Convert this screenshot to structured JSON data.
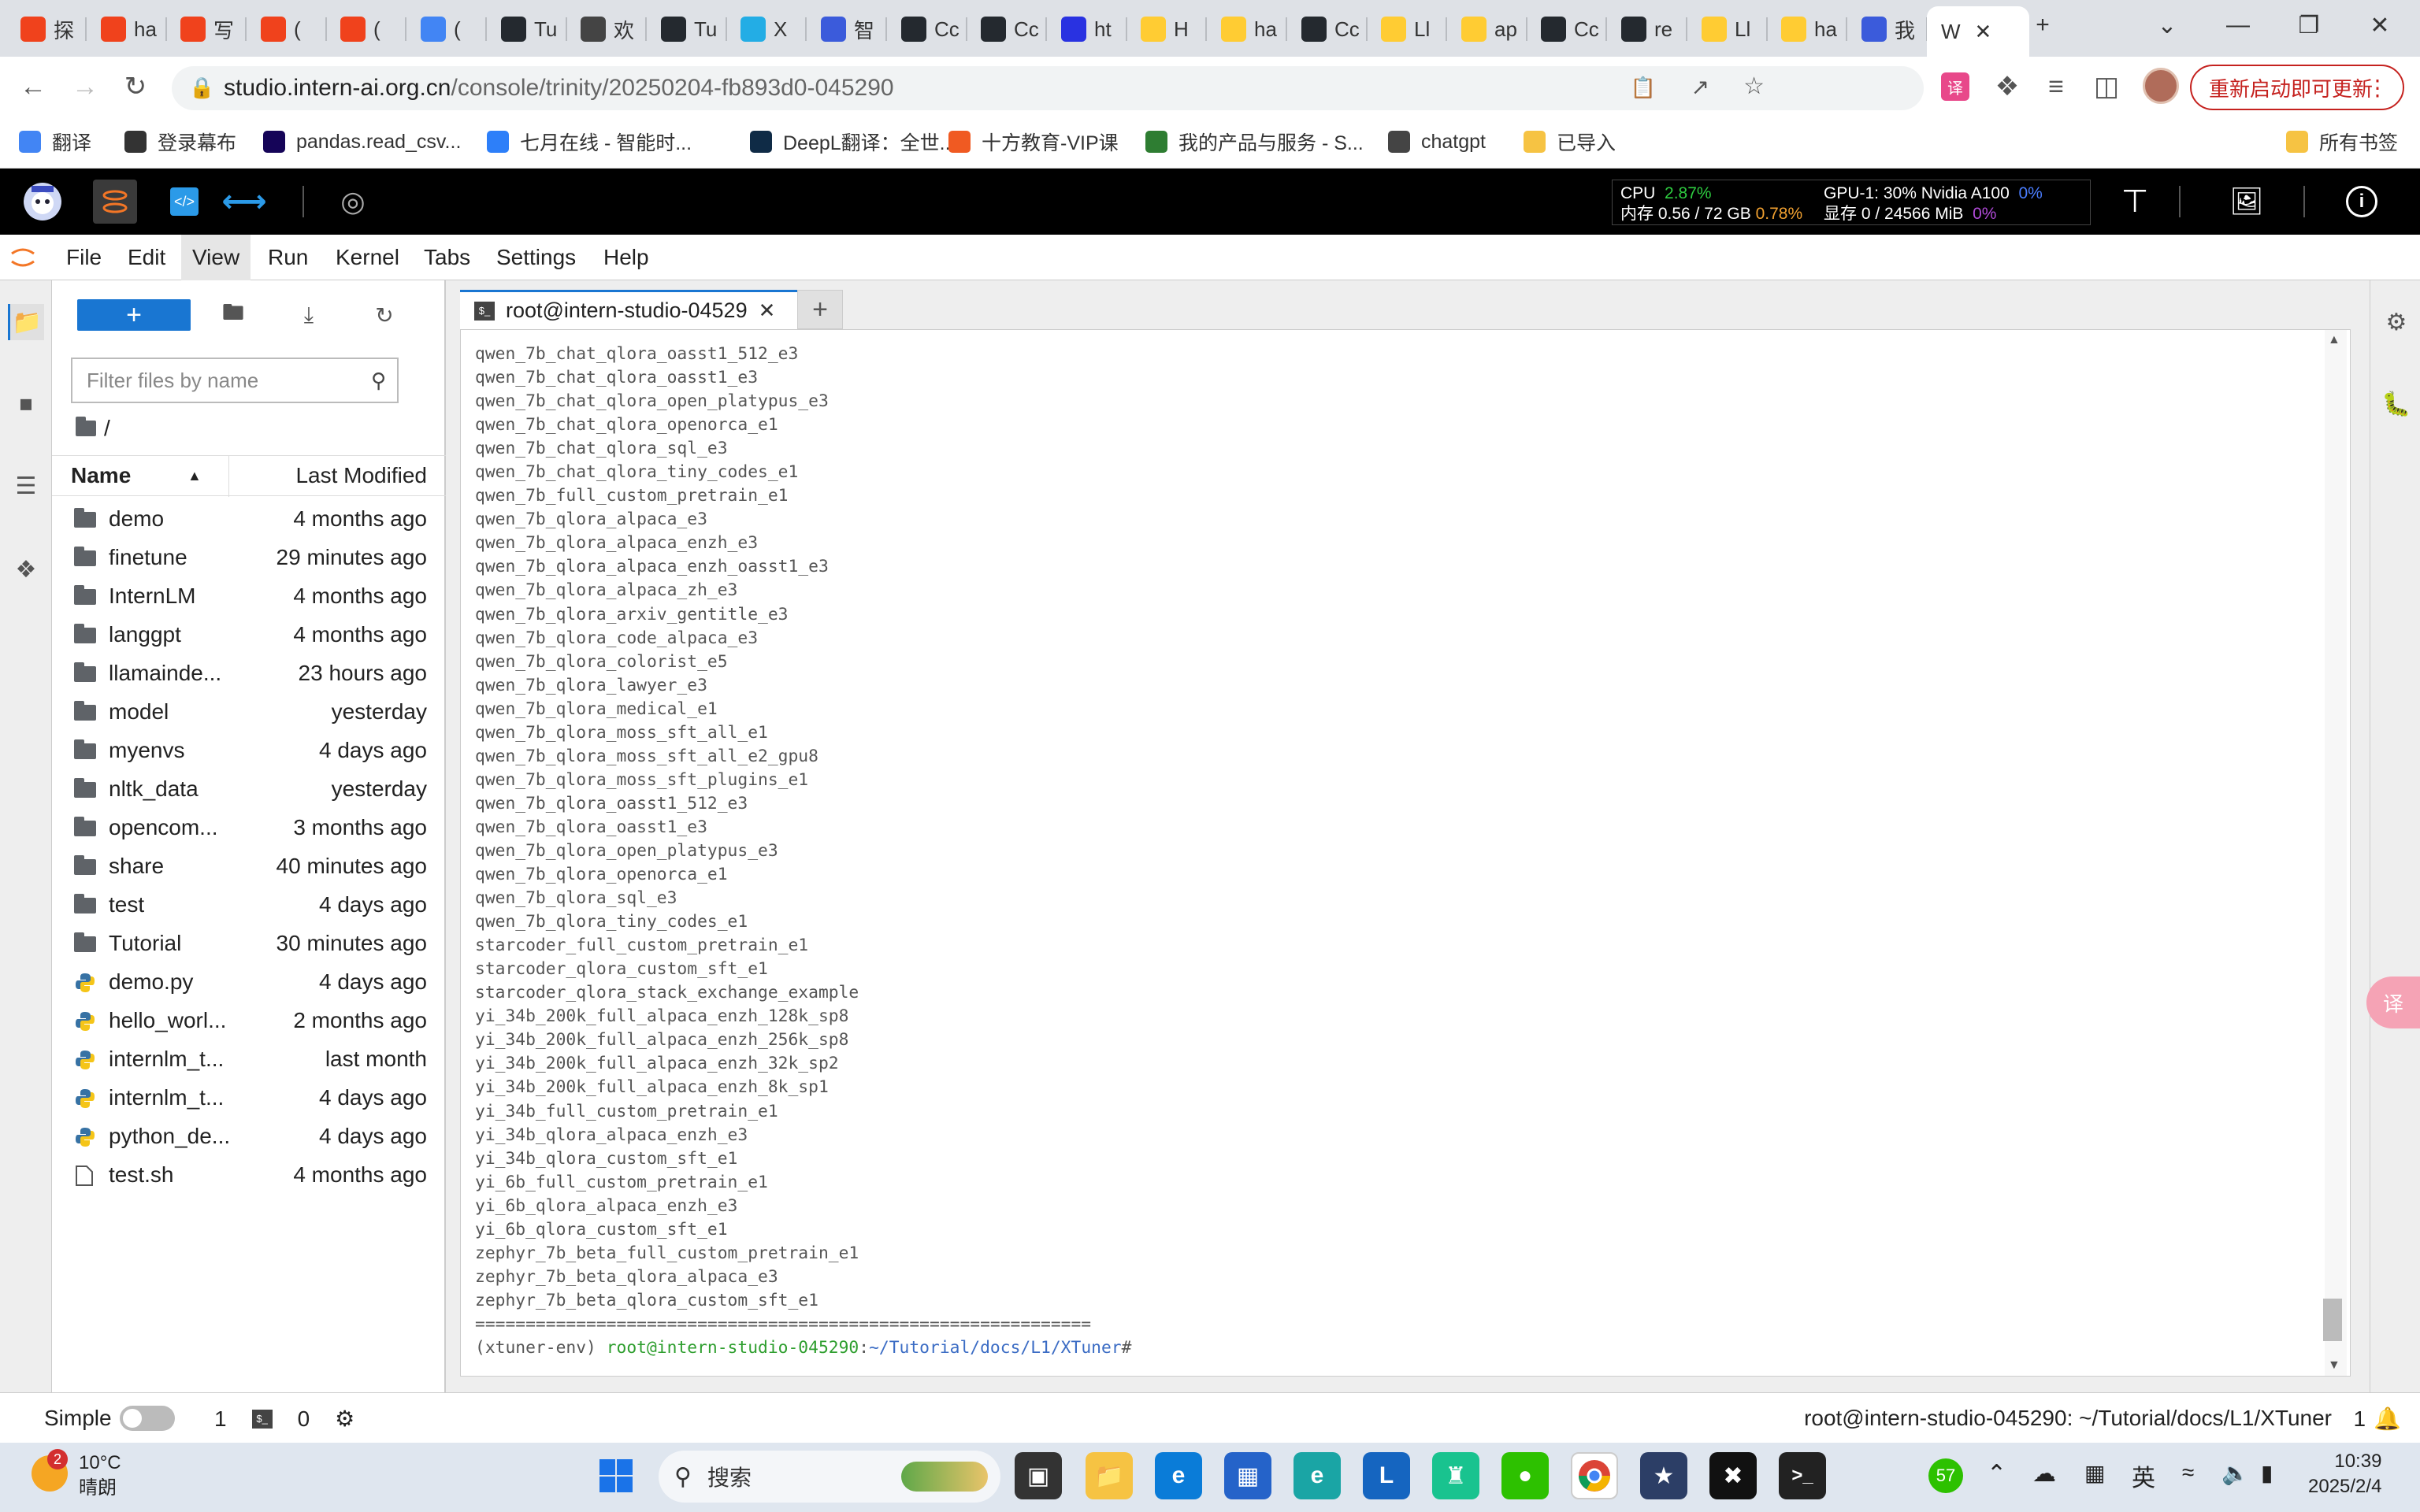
{
  "browser": {
    "tabs": [
      {
        "label": "探",
        "icon": "csdn-icon",
        "color": "#f0421c"
      },
      {
        "label": "ha",
        "icon": "csdn-icon",
        "color": "#f0421c"
      },
      {
        "label": "写",
        "icon": "csdn-icon",
        "color": "#f0421c"
      },
      {
        "label": "(",
        "icon": "csdn-icon",
        "color": "#f0421c"
      },
      {
        "label": "(",
        "icon": "csdn-icon",
        "color": "#f0421c"
      },
      {
        "label": "(",
        "icon": "docs-icon",
        "color": "#4285f4"
      },
      {
        "label": "Tu",
        "icon": "github-icon",
        "color": "#24292f"
      },
      {
        "label": "欢",
        "icon": "reader-icon",
        "color": "#444444"
      },
      {
        "label": "Tu",
        "icon": "github-icon",
        "color": "#24292f"
      },
      {
        "label": "X",
        "icon": "bilibili-icon",
        "color": "#23ade5"
      },
      {
        "label": "智",
        "icon": "intern-icon",
        "color": "#3b5bdb"
      },
      {
        "label": "Cc",
        "icon": "github-icon",
        "color": "#24292f"
      },
      {
        "label": "Cc",
        "icon": "github-icon",
        "color": "#24292f"
      },
      {
        "label": "ht",
        "icon": "baidu-icon",
        "color": "#2932e1"
      },
      {
        "label": "H",
        "icon": "huggingface-icon",
        "color": "#ffcc33"
      },
      {
        "label": "ha",
        "icon": "huggingface-icon",
        "color": "#ffcc33"
      },
      {
        "label": "Cc",
        "icon": "github-icon",
        "color": "#24292f"
      },
      {
        "label": "Ll",
        "icon": "huggingface-icon",
        "color": "#ffcc33"
      },
      {
        "label": "ap",
        "icon": "huggingface-icon",
        "color": "#ffcc33"
      },
      {
        "label": "Cc",
        "icon": "github-icon",
        "color": "#24292f"
      },
      {
        "label": "re",
        "icon": "github-icon",
        "color": "#24292f"
      },
      {
        "label": "Ll",
        "icon": "huggingface-icon",
        "color": "#ffcc33"
      },
      {
        "label": "ha",
        "icon": "huggingface-icon",
        "color": "#ffcc33"
      },
      {
        "label": "我",
        "icon": "intern-icon",
        "color": "#3b5bdb"
      },
      {
        "label": "W",
        "icon": "",
        "color": "#ffffff",
        "active": true
      }
    ],
    "new_tab": "+",
    "url_domain": "studio.intern-ai.org.cn",
    "url_path": "/console/trinity/20250204-fb893d0-045290",
    "update_button": "重新启动即可更新",
    "bookmarks": [
      {
        "label": "翻译",
        "icon": "translate-icon",
        "color": "#4285f4"
      },
      {
        "label": "登录幕布",
        "icon": "mubu-icon",
        "color": "#333333"
      },
      {
        "label": "pandas.read_csv...",
        "icon": "pandas-icon",
        "color": "#150458"
      },
      {
        "label": "七月在线 - 智能时...",
        "icon": "julyedu-icon",
        "color": "#2d7ff9"
      },
      {
        "label": "DeepL翻译：全世...",
        "icon": "deepl-icon",
        "color": "#0f2b46"
      },
      {
        "label": "十方教育-VIP课",
        "icon": "shifang-icon",
        "color": "#f05a22"
      },
      {
        "label": "我的产品与服务 - S...",
        "icon": "service-icon",
        "color": "#2e7d32"
      },
      {
        "label": "chatgpt",
        "icon": "openai-icon",
        "color": "#444444"
      },
      {
        "label": "已导入",
        "icon": "folder-icon",
        "color": "#f6c343"
      }
    ],
    "all_bookmarks": "所有书签"
  },
  "jupyter": {
    "monitor": {
      "cpu_label": "CPU",
      "cpu_value": "2.87%",
      "mem_label": "内存 0.56 / 72 GB",
      "mem_value": "0.78%",
      "gpu_label": "GPU-1: 30% Nvidia A100",
      "gpu_value": "0%",
      "vram_label": "显存 0 / 24566 MiB",
      "vram_value": "0%"
    },
    "menu": [
      "File",
      "Edit",
      "View",
      "Run",
      "Kernel",
      "Tabs",
      "Settings",
      "Help"
    ],
    "filter_placeholder": "Filter files by name",
    "breadcrumb": "/",
    "col_name": "Name",
    "col_modified": "Last Modified",
    "files": [
      {
        "name": "demo",
        "modified": "4 months ago",
        "type": "folder"
      },
      {
        "name": "finetune",
        "modified": "29 minutes ago",
        "type": "folder"
      },
      {
        "name": "InternLM",
        "modified": "4 months ago",
        "type": "folder"
      },
      {
        "name": "langgpt",
        "modified": "4 months ago",
        "type": "folder"
      },
      {
        "name": "llamainde...",
        "modified": "23 hours ago",
        "type": "folder"
      },
      {
        "name": "model",
        "modified": "yesterday",
        "type": "folder"
      },
      {
        "name": "myenvs",
        "modified": "4 days ago",
        "type": "folder"
      },
      {
        "name": "nltk_data",
        "modified": "yesterday",
        "type": "folder"
      },
      {
        "name": "opencom...",
        "modified": "3 months ago",
        "type": "folder"
      },
      {
        "name": "share",
        "modified": "40 minutes ago",
        "type": "folder"
      },
      {
        "name": "test",
        "modified": "4 days ago",
        "type": "folder"
      },
      {
        "name": "Tutorial",
        "modified": "30 minutes ago",
        "type": "folder"
      },
      {
        "name": "demo.py",
        "modified": "4 days ago",
        "type": "python"
      },
      {
        "name": "hello_worl...",
        "modified": "2 months ago",
        "type": "python"
      },
      {
        "name": "internlm_t...",
        "modified": "last month",
        "type": "python"
      },
      {
        "name": "internlm_t...",
        "modified": "4 days ago",
        "type": "python"
      },
      {
        "name": "python_de...",
        "modified": "4 days ago",
        "type": "python"
      },
      {
        "name": "test.sh",
        "modified": "4 months ago",
        "type": "file"
      }
    ],
    "terminal_tab": "root@intern-studio-04529",
    "terminal_lines": [
      "qwen_7b_chat_qlora_oasst1_512_e3",
      "qwen_7b_chat_qlora_oasst1_e3",
      "qwen_7b_chat_qlora_open_platypus_e3",
      "qwen_7b_chat_qlora_openorca_e1",
      "qwen_7b_chat_qlora_sql_e3",
      "qwen_7b_chat_qlora_tiny_codes_e1",
      "qwen_7b_full_custom_pretrain_e1",
      "qwen_7b_qlora_alpaca_e3",
      "qwen_7b_qlora_alpaca_enzh_e3",
      "qwen_7b_qlora_alpaca_enzh_oasst1_e3",
      "qwen_7b_qlora_alpaca_zh_e3",
      "qwen_7b_qlora_arxiv_gentitle_e3",
      "qwen_7b_qlora_code_alpaca_e3",
      "qwen_7b_qlora_colorist_e5",
      "qwen_7b_qlora_lawyer_e3",
      "qwen_7b_qlora_medical_e1",
      "qwen_7b_qlora_moss_sft_all_e1",
      "qwen_7b_qlora_moss_sft_all_e2_gpu8",
      "qwen_7b_qlora_moss_sft_plugins_e1",
      "qwen_7b_qlora_oasst1_512_e3",
      "qwen_7b_qlora_oasst1_e3",
      "qwen_7b_qlora_open_platypus_e3",
      "qwen_7b_qlora_openorca_e1",
      "qwen_7b_qlora_sql_e3",
      "qwen_7b_qlora_tiny_codes_e1",
      "starcoder_full_custom_pretrain_e1",
      "starcoder_qlora_custom_sft_e1",
      "starcoder_qlora_stack_exchange_example",
      "yi_34b_200k_full_alpaca_enzh_128k_sp8",
      "yi_34b_200k_full_alpaca_enzh_256k_sp8",
      "yi_34b_200k_full_alpaca_enzh_32k_sp2",
      "yi_34b_200k_full_alpaca_enzh_8k_sp1",
      "yi_34b_full_custom_pretrain_e1",
      "yi_34b_qlora_alpaca_enzh_e3",
      "yi_34b_qlora_custom_sft_e1",
      "yi_6b_full_custom_pretrain_e1",
      "yi_6b_qlora_alpaca_enzh_e3",
      "yi_6b_qlora_custom_sft_e1",
      "zephyr_7b_beta_full_custom_pretrain_e1",
      "zephyr_7b_beta_qlora_alpaca_e3",
      "zephyr_7b_beta_qlora_custom_sft_e1",
      "============================================================="
    ],
    "prompt_env": "(xtuner-env) ",
    "prompt_user": "root@intern-studio-045290",
    "prompt_colon": ":",
    "prompt_path": "~/Tutorial/docs/L1/XTuner",
    "prompt_end": "#",
    "status": {
      "mode": "Simple",
      "count1": "1",
      "count2": "0",
      "path": "root@intern-studio-045290: ~/Tutorial/docs/L1/XTuner",
      "notifications": "1"
    }
  },
  "taskbar": {
    "weather_badge": "2",
    "temperature": "10°C",
    "weather": "晴朗",
    "search": "搜索",
    "badge": "57",
    "ime": "英",
    "time": "10:39",
    "date": "2025/2/4"
  },
  "colors": {
    "jupyter_blue": "#1976d2",
    "terminal_green": "#2e9e2e",
    "terminal_path": "#3b6cc4",
    "update_red": "#c5221f",
    "cpu_green": "#2ecc40",
    "mem_orange": "#f0a030",
    "gpu_blue": "#4a7dff",
    "vram_purple": "#b04ad8"
  }
}
